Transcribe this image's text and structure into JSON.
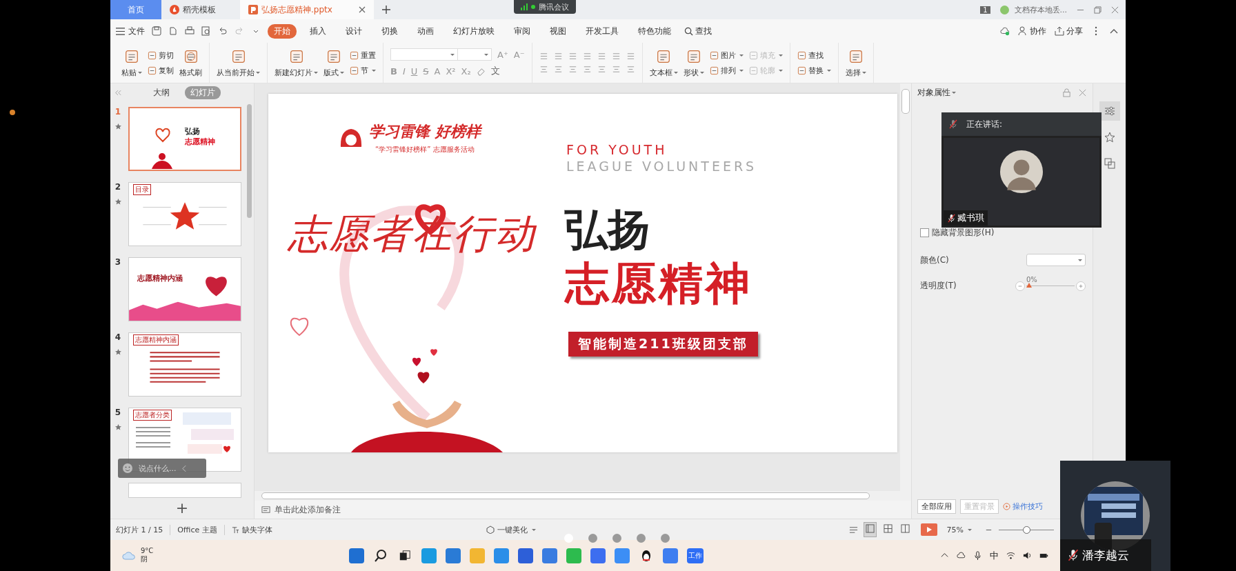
{
  "top_tabs": [
    {
      "label": "首页",
      "kind": "home",
      "selected": false
    },
    {
      "label": "稻壳模板",
      "kind": "docer",
      "selected": false
    },
    {
      "label": "弘扬志愿精神.pptx",
      "kind": "doc",
      "selected": true
    }
  ],
  "meeting_pill": "腾讯会议",
  "title_right": {
    "badge": "1",
    "notice": "文档存本地丢..."
  },
  "menu": {
    "file": "文件",
    "tabs": [
      {
        "label": "开始",
        "selected": true
      },
      {
        "label": "插入",
        "selected": false
      },
      {
        "label": "设计",
        "selected": false
      },
      {
        "label": "切换",
        "selected": false
      },
      {
        "label": "动画",
        "selected": false
      },
      {
        "label": "幻灯片放映",
        "selected": false
      },
      {
        "label": "审阅",
        "selected": false
      },
      {
        "label": "视图",
        "selected": false
      },
      {
        "label": "开发工具",
        "selected": false
      },
      {
        "label": "特色功能",
        "selected": false
      }
    ],
    "search": "查找",
    "actions": [
      "协作",
      "分享"
    ]
  },
  "ribbon": [
    {
      "kind": "tools",
      "columns": [
        {
          "kind": "big",
          "label": "粘贴",
          "dropdown": true
        },
        {
          "kind": "stack",
          "items": [
            {
              "label": "剪切",
              "dropdown": false,
              "disabled": false
            },
            {
              "label": "复制",
              "dropdown": false,
              "disabled": false
            }
          ]
        },
        {
          "kind": "big",
          "label": "格式刷",
          "dropdown": false
        }
      ]
    },
    {
      "kind": "tools",
      "columns": [
        {
          "kind": "big",
          "label": "从当前开始",
          "dropdown": true
        }
      ]
    },
    {
      "kind": "tools",
      "columns": [
        {
          "kind": "big",
          "label": "新建幻灯片",
          "dropdown": true
        },
        {
          "kind": "big",
          "label": "版式",
          "dropdown": true
        },
        {
          "kind": "stack",
          "items": [
            {
              "label": "重置",
              "dropdown": false,
              "disabled": false
            },
            {
              "label": "节",
              "dropdown": true,
              "disabled": false
            }
          ]
        }
      ]
    },
    {
      "kind": "font",
      "size_buttons": [
        "A⁺",
        "A⁻"
      ],
      "format_buttons": [
        "B",
        "I",
        "U",
        "S",
        "A",
        "X²",
        "X₂"
      ],
      "extra": "文"
    },
    {
      "kind": "paragraph"
    },
    {
      "kind": "tools",
      "columns": [
        {
          "kind": "big",
          "label": "文本框",
          "dropdown": true
        },
        {
          "kind": "big",
          "label": "形状",
          "dropdown": true
        },
        {
          "kind": "stack",
          "items": [
            {
              "label": "图片",
              "dropdown": true,
              "disabled": false
            },
            {
              "label": "排列",
              "dropdown": true,
              "disabled": false
            }
          ]
        },
        {
          "kind": "stack",
          "items": [
            {
              "label": "填充",
              "dropdown": true,
              "disabled": true
            },
            {
              "label": "轮廓",
              "dropdown": true,
              "disabled": true
            }
          ]
        }
      ]
    },
    {
      "kind": "tools",
      "columns": [
        {
          "kind": "stack",
          "items": [
            {
              "label": "查找",
              "dropdown": false,
              "disabled": false
            },
            {
              "label": "替换",
              "dropdown": true,
              "disabled": false
            }
          ]
        }
      ]
    },
    {
      "kind": "tools",
      "columns": [
        {
          "kind": "big",
          "label": "选择",
          "dropdown": true
        }
      ]
    }
  ],
  "left_panel": {
    "tabs": [
      {
        "label": "大纲",
        "selected": false
      },
      {
        "label": "幻灯片",
        "selected": true
      }
    ],
    "slides": [
      {
        "number": "1",
        "selected": true,
        "animated": true,
        "kind": "cover",
        "lines": [
          "弘扬",
          "志愿精神"
        ]
      },
      {
        "number": "2",
        "selected": false,
        "animated": true,
        "kind": "contents",
        "lines": [
          "目录"
        ]
      },
      {
        "number": "3",
        "selected": false,
        "animated": false,
        "kind": "section",
        "lines": [
          "志愿精神内涵"
        ]
      },
      {
        "number": "4",
        "selected": false,
        "animated": true,
        "kind": "text",
        "lines": [
          "志愿精神内涵"
        ]
      },
      {
        "number": "5",
        "selected": false,
        "animated": true,
        "kind": "collage",
        "lines": [
          "志愿者分类"
        ]
      }
    ],
    "add": "+"
  },
  "chat_bubble": "说点什么...",
  "slide": {
    "logo": "学习雷锋  好榜样",
    "logo_sub": "“学习雷锋好榜样” 志愿服务活动",
    "en_line1": "FOR YOUTH",
    "en_line2": "LEAGUE VOLUNTEERS",
    "calligraphy": "志愿者在行动",
    "title1": "弘扬",
    "title2": "志愿精神",
    "banner": "智能制造211班级团支部"
  },
  "notes": "单击此处添加备注",
  "right_panel": {
    "title": "对象属性",
    "hide_bg": {
      "label": "隐藏背景图形(H)",
      "checked": false
    },
    "color_label": "颜色(C)",
    "opacity_label": "透明度(T)",
    "opacity_reading": "0%",
    "opacity": {
      "level": 0
    },
    "buttons": [
      {
        "label": "全部应用",
        "disabled": false
      },
      {
        "label": "重置背景",
        "disabled": true
      }
    ],
    "tips": "操作技巧"
  },
  "status": {
    "slide": "幻灯片 1 / 15",
    "theme": "Office 主题",
    "missing_font": "缺失字体",
    "beautify": "一键美化",
    "views": [
      {
        "selected": true
      },
      {
        "selected": false
      },
      {
        "selected": false
      }
    ],
    "zoom": "75%",
    "zoom_slider": {
      "level": 0.5
    }
  },
  "pager": [
    {
      "selected": true
    },
    {
      "selected": false
    },
    {
      "selected": false
    },
    {
      "selected": false
    },
    {
      "selected": false
    }
  ],
  "taskbar": {
    "weather": {
      "temp": "9°C",
      "desc": "阴"
    },
    "apps": [
      {
        "kind": "start"
      },
      {
        "kind": "search"
      },
      {
        "kind": "taskview"
      },
      {
        "kind": "edge"
      },
      {
        "kind": "mail"
      },
      {
        "kind": "folder"
      },
      {
        "kind": "browser"
      },
      {
        "kind": "circle"
      },
      {
        "kind": "chat"
      },
      {
        "kind": "wechat"
      },
      {
        "kind": "wps"
      },
      {
        "kind": "plane"
      },
      {
        "kind": "penguin"
      },
      {
        "kind": "cloud"
      },
      {
        "kind": "work",
        "label": "工作"
      }
    ],
    "ime": "中"
  },
  "meeting": {
    "speaking_label": "正在讲话:",
    "speaker": "臧书琪",
    "muted": true
  },
  "video": {
    "name": "潘李越云",
    "muted": true
  }
}
